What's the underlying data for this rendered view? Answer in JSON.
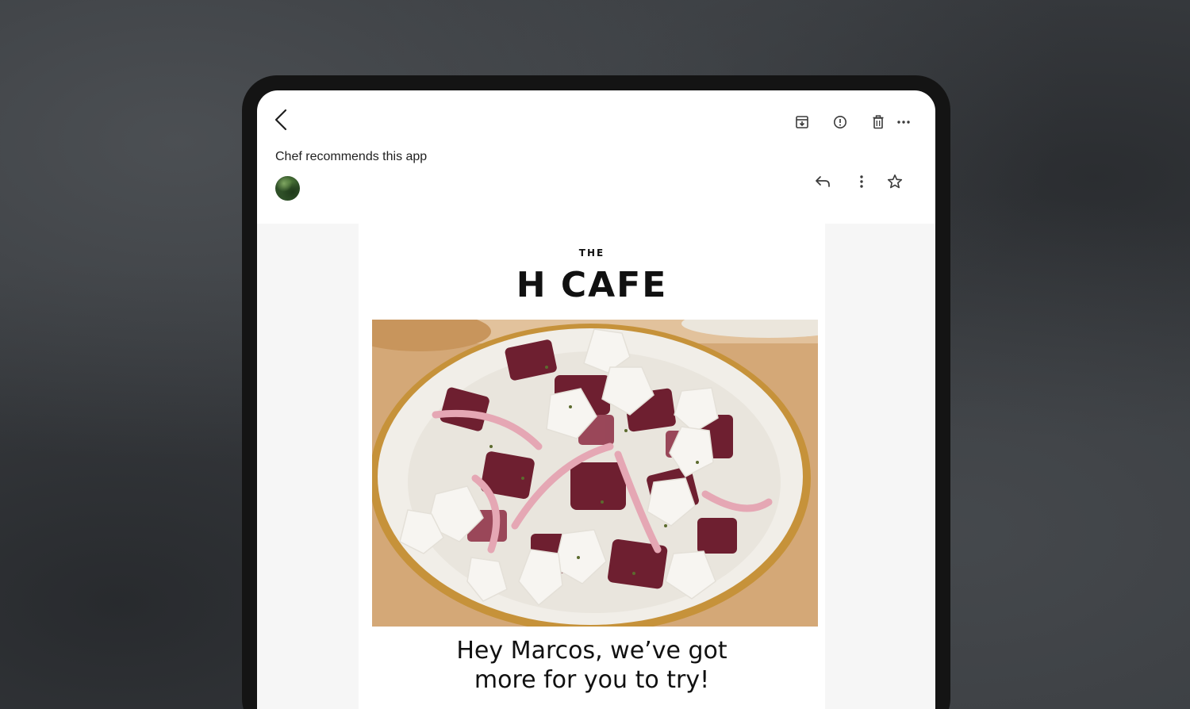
{
  "email": {
    "subject": "Chef recommends this app"
  },
  "toolbar": {
    "back_icon": "chevron-left-icon",
    "archive_icon": "archive-icon",
    "report_icon": "alert-circle-icon",
    "delete_icon": "trash-icon",
    "more_icon": "more-horizontal-icon"
  },
  "message_actions": {
    "reply_icon": "reply-icon",
    "menu_icon": "more-vertical-icon",
    "star_icon": "star-icon"
  },
  "newsletter": {
    "brand_prefix": "THE",
    "brand_name": "H CAFE",
    "headline_line1": "Hey Marcos, we’ve got",
    "headline_line2": "more for you to try!"
  },
  "colors": {
    "background": "#3a3d41",
    "device_bezel": "#141414",
    "screen": "#ffffff",
    "mail_canvas": "#f6f6f6",
    "text": "#111111"
  }
}
